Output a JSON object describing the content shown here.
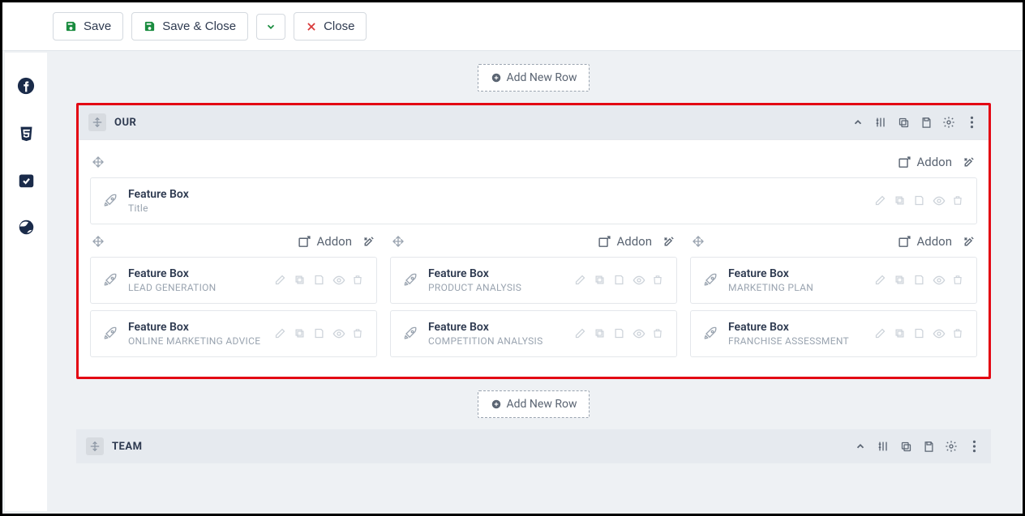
{
  "toolbar": {
    "save": "Save",
    "save_close": "Save & Close",
    "close": "Close"
  },
  "canvas": {
    "add_row": "Add New Row",
    "addon_label": "Addon"
  },
  "sections": [
    {
      "title": "OUR"
    },
    {
      "title": "TEAM"
    }
  ],
  "title_block": {
    "name": "Feature Box",
    "sub": "Title"
  },
  "features": {
    "col0": [
      {
        "name": "Feature Box",
        "sub": "LEAD GENERATION"
      },
      {
        "name": "Feature Box",
        "sub": "ONLINE MARKETING ADVICE"
      }
    ],
    "col1": [
      {
        "name": "Feature Box",
        "sub": "PRODUCT ANALYSIS"
      },
      {
        "name": "Feature Box",
        "sub": "COMPETITION ANALYSIS"
      }
    ],
    "col2": [
      {
        "name": "Feature Box",
        "sub": "MARKETING PLAN"
      },
      {
        "name": "Feature Box",
        "sub": "FRANCHISE ASSESSMENT"
      }
    ]
  },
  "colors": {
    "highlight_border": "#e30613",
    "green": "#1a8c3f",
    "red": "#d93939",
    "muted": "#9aa4b0"
  }
}
